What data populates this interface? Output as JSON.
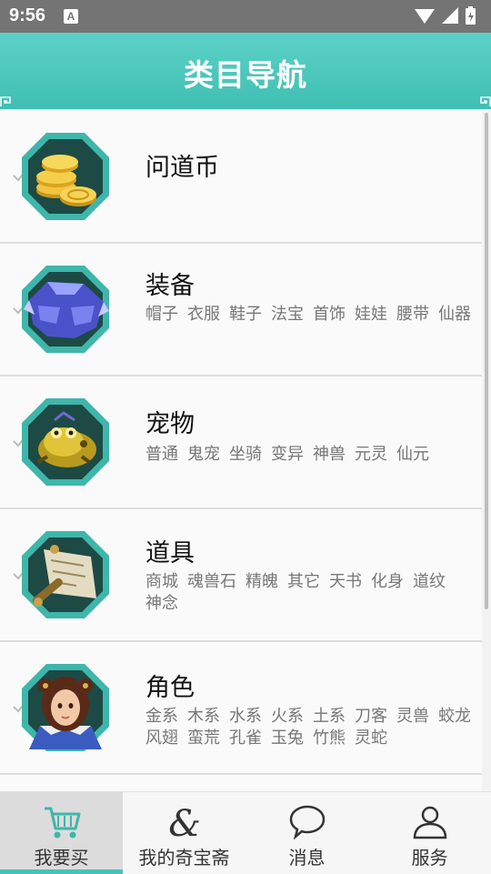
{
  "status_bar": {
    "time": "9:56",
    "notification_letter": "A"
  },
  "header": {
    "title": "类目导航"
  },
  "categories": [
    {
      "name": "问道币",
      "icon": "gold-coins-icon",
      "subs": []
    },
    {
      "name": "装备",
      "icon": "armor-icon",
      "subs": [
        "帽子",
        "衣服",
        "鞋子",
        "法宝",
        "首饰",
        "娃娃",
        "腰带",
        "仙器"
      ]
    },
    {
      "name": "宠物",
      "icon": "pet-toad-icon",
      "subs": [
        "普通",
        "鬼宠",
        "坐骑",
        "变异",
        "神兽",
        "元灵",
        "仙元"
      ]
    },
    {
      "name": "道具",
      "icon": "scroll-icon",
      "subs": [
        "商城",
        "魂兽石",
        "精魄",
        "其它",
        "天书",
        "化身",
        "道纹",
        "神念"
      ]
    },
    {
      "name": "角色",
      "icon": "character-portrait-icon",
      "subs": [
        "金系",
        "木系",
        "水系",
        "火系",
        "土系",
        "刀客",
        "灵兽",
        "蛟龙",
        "风翅",
        "蛮荒",
        "孔雀",
        "玉兔",
        "竹熊",
        "灵蛇"
      ]
    }
  ],
  "bottom_nav": {
    "tabs": [
      {
        "label": "我要买",
        "icon": "cart-icon",
        "active": true
      },
      {
        "label": "我的奇宝斋",
        "icon": "ampersand-icon",
        "active": false
      },
      {
        "label": "消息",
        "icon": "chat-bubble-icon",
        "active": false
      },
      {
        "label": "服务",
        "icon": "person-icon",
        "active": false
      }
    ]
  },
  "colors": {
    "accent": "#45c3b7",
    "header": "#4ec8bc",
    "badge_ring": "#3fb6ab",
    "badge_fill": "#1d4a45"
  }
}
